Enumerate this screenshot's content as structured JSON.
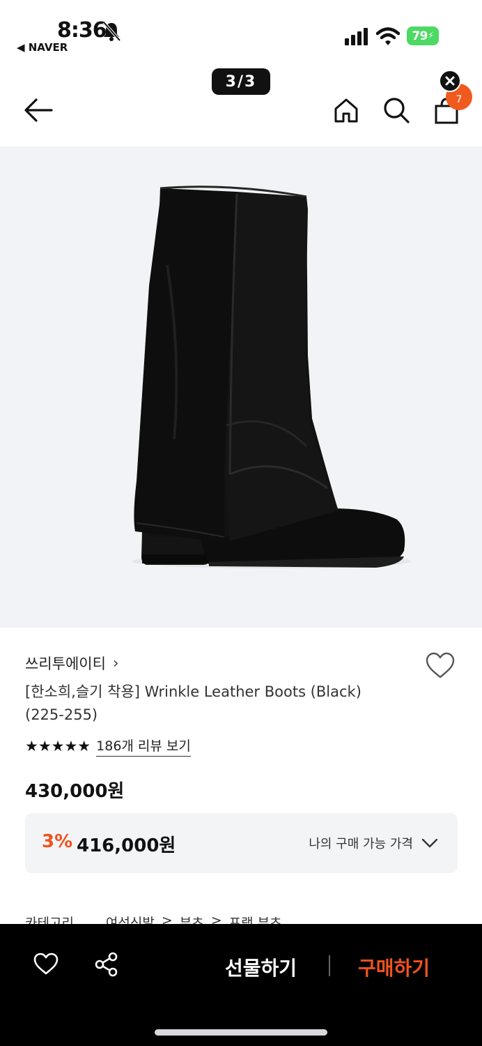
{
  "status_bar": {
    "time": "8:36",
    "back_app": "◀ NAVER",
    "battery": "79"
  },
  "header": {
    "page_counter": "3/3",
    "cart_count": "7"
  },
  "product": {
    "brand": "쓰리투에이티",
    "brand_chevron": "›",
    "title": "[한소희,슬기 착용] Wrinkle Leather Boots (Black) (225-255)",
    "rating_stars": "★★★★★",
    "review_link": "186개 리뷰 보기",
    "price": "430,000원",
    "discount": {
      "rate": "3%",
      "price": "416,000원",
      "my_price_label": "나의 구매 가능 가격"
    },
    "category": {
      "label": "카테고리",
      "path": [
        "여성신발",
        ">",
        "부츠",
        ">",
        "프랭 부츠"
      ]
    }
  },
  "bottom_bar": {
    "gift": "선물하기",
    "buy": "구매하기"
  },
  "colors": {
    "accent": "#f05a1e",
    "discount_box": "#f3f4f6",
    "image_bg": "#f1f3f6"
  },
  "icons": [
    "back-arrow-icon",
    "home-icon",
    "search-icon",
    "cart-icon",
    "close-icon",
    "heart-icon",
    "share-icon",
    "chevron-down-icon",
    "wifi-icon",
    "bell-muted-icon"
  ]
}
